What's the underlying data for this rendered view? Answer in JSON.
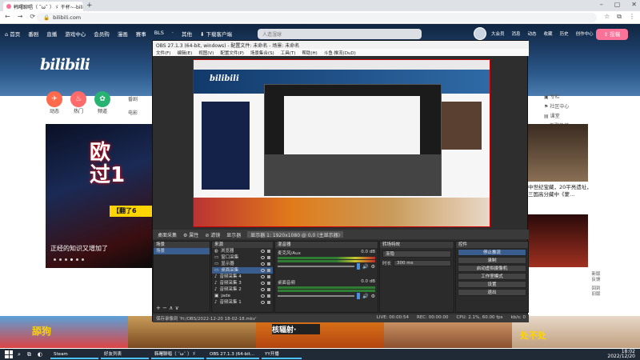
{
  "browser": {
    "tab_title": "韩曙聊唱（ ˘ω˘ ）ゞ 干杯~-bili",
    "new_tab": "+",
    "window_controls": [
      "–",
      "▢",
      "✕"
    ],
    "nav": [
      "←",
      "→",
      "⟳"
    ],
    "url": "bilibili.com",
    "toolbar_icons": [
      "☆",
      "⧉",
      "⋮"
    ]
  },
  "bili_header": {
    "nav": [
      "⌂ 首页",
      "番剧",
      "直播",
      "游戏中心",
      "会员购",
      "漫画",
      "赛事",
      "BLS",
      "·",
      "其他",
      "⬇ 下载客户端"
    ],
    "search_placeholder": "人造湿球",
    "right": [
      "大会员",
      "消息",
      "动态",
      "收藏",
      "历史",
      "创作中心"
    ],
    "upload": "⇪ 投稿",
    "logo": "bilibili"
  },
  "bili_body": {
    "circles": [
      {
        "label": "动态",
        "icon": "✈",
        "color": "#ff6a4d"
      },
      {
        "label": "热门",
        "icon": "🔥",
        "color": "#ff6b6b"
      },
      {
        "label": "频道",
        "icon": "✿",
        "color": "#28b373"
      }
    ],
    "chips": [
      "番剧",
      "电影"
    ],
    "side_menu": [
      "▣ 专栏",
      "⚑ 社区中心",
      "▤ 课堂",
      "◎ 新歌热榜"
    ],
    "hero_big": "欧\n过1",
    "hero_bar": "【翻了6",
    "hero_caption": "正经的知识又增加了",
    "right_caption1": "中世纪宝藏，20平亮遗址，三国高分藏中《蒙…",
    "right_caption2": "",
    "float_btns": [
      "新版反馈",
      "回到旧版"
    ],
    "bottom_labels": [
      "舔狗",
      "核辐射·",
      "处不处"
    ]
  },
  "obs": {
    "title": "OBS 27.1.3 (64-bit, windows) - 配置文件: 未命名 - 场景: 未命名",
    "menu": [
      "文件(F)",
      "编辑(E)",
      "视图(V)",
      "配置文件(P)",
      "场景集合(S)",
      "工具(T)",
      "帮助(H)",
      "斗鱼·推流(DuD)"
    ],
    "toolbar": [
      "桌面采集",
      "⚙ 属性",
      "⊘ 滤镜",
      "显示器",
      "显示器 1: 1920x1080 @ 0,0 (主显示器)"
    ],
    "scenes_title": "场景",
    "scenes": [
      "场景"
    ],
    "sources_title": "来源",
    "sources": [
      "浏览器",
      "窗口采集",
      "显示器",
      "桌面采集",
      "音频采集 4",
      "音频采集 3",
      "音频采集 2",
      "jade",
      "音频采集 1"
    ],
    "mixer_title": "混音器",
    "mixer": [
      {
        "name": "麦克风/Aux",
        "db": "0.0 dB"
      },
      {
        "name": "桌面音频",
        "db": "0.0 dB"
      }
    ],
    "transitions_title": "转场特效",
    "transition": "渐隐",
    "duration_label": "时长",
    "duration": "300 ms",
    "controls_title": "控件",
    "controls": [
      "停止推流",
      "录制",
      "启动虚拟摄像机",
      "工作室模式",
      "设置",
      "退出"
    ],
    "status": [
      "保存录像到 'H:/OBS/2022-12-20 18-02-18.mkv'",
      "LIVE: 00:00:54",
      "REC: 00:00:00",
      "CPU: 2.1%, 60.00 fps",
      "kb/s: 0"
    ]
  },
  "taskbar": {
    "apps": [
      "Steam",
      "好友列表",
      "韩曙聊唱（ ˘ω˘ ）ゞ",
      "OBS 27.1.3 (64-bit...",
      "YY开播"
    ],
    "time": "18:02",
    "date": "2022/12/20"
  }
}
